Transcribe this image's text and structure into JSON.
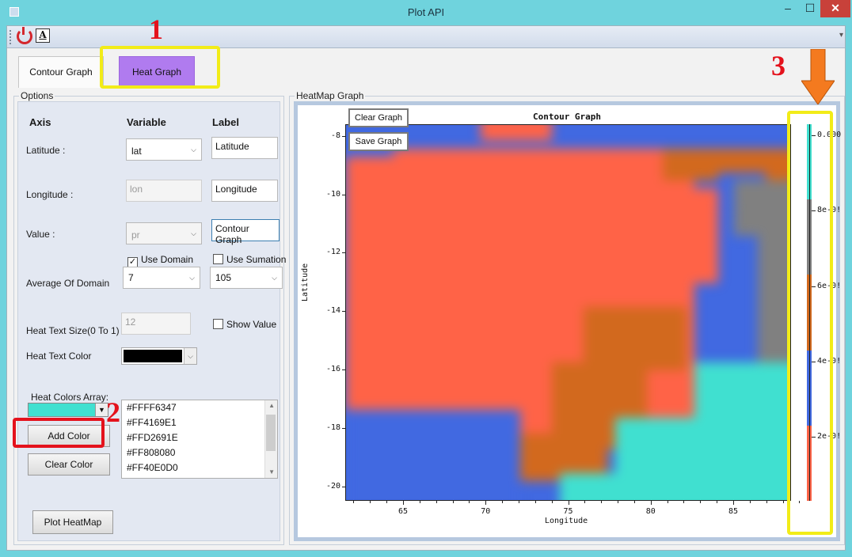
{
  "window": {
    "title": "Plot API"
  },
  "tabs": {
    "contour": "Contour Graph",
    "heat": "Heat Graph"
  },
  "annotations": [
    "1",
    "2",
    "3"
  ],
  "options": {
    "group_title": "Options",
    "headers": {
      "axis": "Axis",
      "variable": "Variable",
      "label": "Label"
    },
    "rows": {
      "latitude": {
        "label": "Latitude :",
        "variable": "lat",
        "text": "Latitude"
      },
      "longitude": {
        "label": "Longitude :",
        "variable": "lon",
        "text": "Longitude"
      },
      "value": {
        "label": "Value :",
        "variable": "pr",
        "text": "Contour Graph"
      }
    },
    "use_domain": "Use Domain",
    "use_sumation": "Use Sumation",
    "average_of_domain": {
      "label": "Average Of Domain",
      "value1": "7",
      "value2": "105"
    },
    "heat_text_size": {
      "label": "Heat Text Size(0 To 1)",
      "value": "12"
    },
    "show_value": "Show Value",
    "heat_text_color": {
      "label": "Heat Text Color",
      "color": "#000000"
    },
    "heat_colors_array": {
      "label": "Heat Colors Array:",
      "selected_color": "#40E0D0",
      "colors": [
        "#FFFF6347",
        "#FF4169E1",
        "#FFD2691E",
        "#FF808080",
        "#FF40E0D0"
      ]
    },
    "add_color": "Add Color",
    "clear_color": "Clear Color",
    "plot_heatmap": "Plot HeatMap"
  },
  "heatmap_panel": {
    "group_title": "HeatMap Graph",
    "clear_graph": "Clear Graph",
    "save_graph": "Save Graph"
  },
  "chart_data": {
    "type": "heatmap",
    "title": "Contour Graph",
    "xlabel": "Longitude",
    "ylabel": "Latitude",
    "x_ticks": [
      "65",
      "70",
      "75",
      "80",
      "85"
    ],
    "y_ticks": [
      "-8",
      "-10",
      "-12",
      "-14",
      "-16",
      "-18",
      "-20"
    ],
    "xlim": [
      61.5,
      88.5
    ],
    "ylim": [
      -20.5,
      -7.6
    ],
    "colorbar": {
      "colors": [
        "#FF6347",
        "#4169E1",
        "#D2691E",
        "#808080",
        "#40E0D0"
      ],
      "tick_labels": [
        "2e-0!",
        "4e-0!",
        "6e-0!",
        "8e-0!",
        "0.000"
      ]
    }
  }
}
